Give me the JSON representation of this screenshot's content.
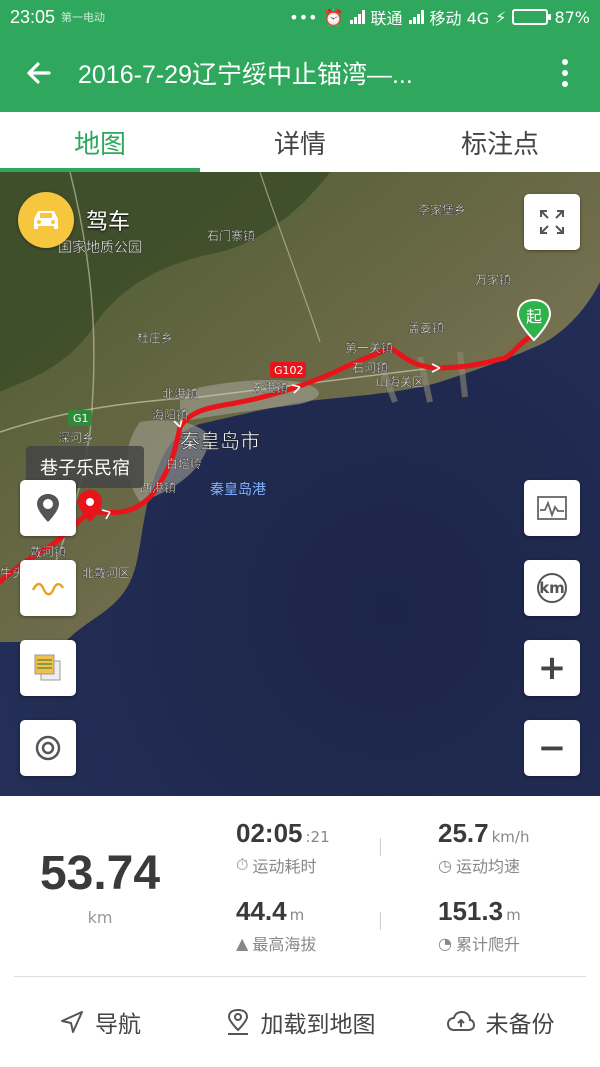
{
  "statusbar": {
    "time": "23:05",
    "watermark": "第一电动",
    "carrier1": "联通",
    "carrier2": "移动 4G",
    "battery": "87%",
    "battery_level": 0.87
  },
  "appbar": {
    "title": "2016-7-29辽宁绥中止锚湾—..."
  },
  "tabs": [
    {
      "label": "地图",
      "active": true
    },
    {
      "label": "详情",
      "active": false
    },
    {
      "label": "标注点",
      "active": false
    }
  ],
  "map": {
    "mode_label": "驾车",
    "poi_label": "巷子乐民宿",
    "start_label": "起",
    "places": {
      "lijiabao": "李家堡乡",
      "shimenzhai": "石门寨镇",
      "wanjia": "万家镇",
      "dushan": "杜庄乡",
      "mengjiang": "孟姜镇",
      "diyiguan": "第一关镇",
      "shihe": "石河镇",
      "shanhaiguan": "山海关区",
      "beigang": "北港镇",
      "haiyang": "海阳镇",
      "donggang": "东港镇",
      "qhd": "秦皇岛市",
      "qhdport": "秦皇岛港",
      "shenhe": "深河乡",
      "baita": "白塔岭",
      "xigang": "西港镇",
      "daihe": "戴河镇",
      "beidaihe": "北戴河区",
      "niutou": "牛头",
      "park": "国家地质公园",
      "road_g102": "G102",
      "road_g1": "G1"
    },
    "buttons": {
      "fullscreen": "fullscreen-icon",
      "profile": "elevation-chart-icon",
      "km": "km",
      "zoom_in": "+",
      "zoom_out": "−"
    },
    "route_color": "#e8141a"
  },
  "stats": {
    "distance": "53.74",
    "distance_unit": "km",
    "duration": "02:05",
    "duration_sec": ":21",
    "duration_label": "运动耗时",
    "avg_speed": "25.7",
    "avg_speed_unit": "km/h",
    "avg_speed_label": "运动均速",
    "max_alt": "44.4",
    "max_alt_unit": "m",
    "max_alt_label": "最高海拔",
    "climb": "151.3",
    "climb_unit": "m",
    "climb_label": "累计爬升"
  },
  "actions": {
    "navigate": "导航",
    "load_map": "加载到地图",
    "backup": "未备份"
  },
  "colors": {
    "brand": "#2fa85d",
    "route": "#e8141a"
  }
}
